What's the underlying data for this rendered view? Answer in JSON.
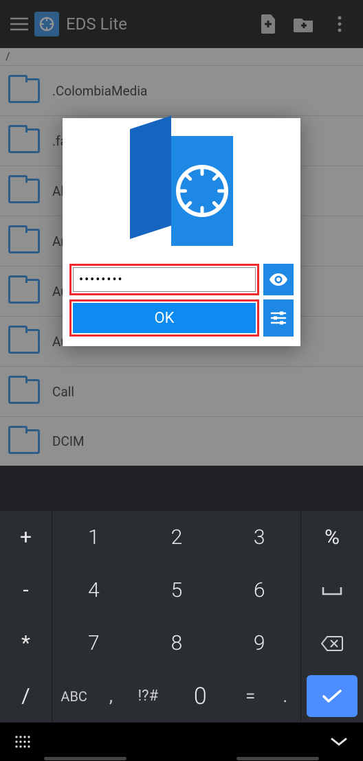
{
  "appbar": {
    "title": "EDS Lite"
  },
  "breadcrumb": "/",
  "folders": [
    {
      "name": ".ColombiaMedia"
    },
    {
      "name": ".fa"
    },
    {
      "name": "Al"
    },
    {
      "name": "An"
    },
    {
      "name": "Au"
    },
    {
      "name": "Autodesk"
    },
    {
      "name": "Call"
    },
    {
      "name": "DCIM"
    }
  ],
  "dialog": {
    "password_value": "••••••••",
    "ok_label": "OK"
  },
  "keyboard": {
    "side_left": [
      "+",
      "-",
      "*",
      "/"
    ],
    "numbers": [
      [
        "1",
        "2",
        "3"
      ],
      [
        "4",
        "5",
        "6"
      ],
      [
        "7",
        "8",
        "9"
      ]
    ],
    "side_right_percent": "%",
    "side_right_space": "␣",
    "abc_label": "ABC",
    "comma": ",",
    "symbols": "!?#",
    "zero": "0",
    "equals": "=",
    "dot": "."
  }
}
